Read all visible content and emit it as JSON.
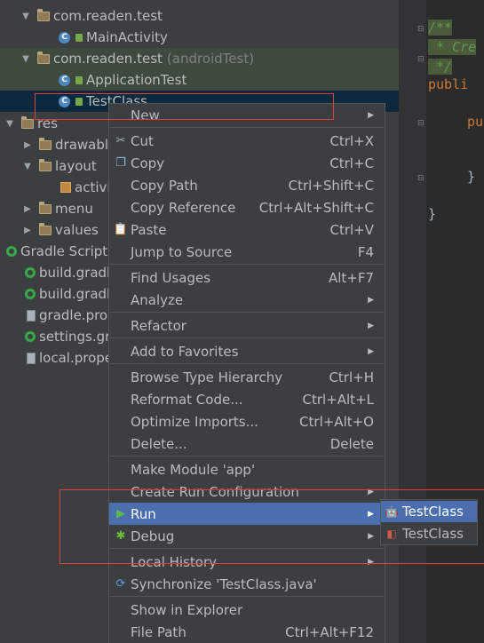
{
  "tree": {
    "rows": [
      {
        "label": "com.readen.test",
        "extra": ""
      },
      {
        "label": "MainActivity",
        "extra": ""
      },
      {
        "label": "com.readen.test",
        "extra": "(androidTest)"
      },
      {
        "label": "ApplicationTest",
        "extra": ""
      },
      {
        "label": "TestClass",
        "extra": ""
      },
      {
        "label": "res",
        "extra": ""
      },
      {
        "label": "drawabl",
        "extra": ""
      },
      {
        "label": "layout",
        "extra": ""
      },
      {
        "label": "activi",
        "extra": ""
      },
      {
        "label": "menu",
        "extra": ""
      },
      {
        "label": "values",
        "extra": ""
      },
      {
        "label": "Gradle Scripts",
        "extra": ""
      },
      {
        "label": "build.gradl",
        "extra": ""
      },
      {
        "label": "build.gradl",
        "extra": ""
      },
      {
        "label": "gradle.pro",
        "extra": ""
      },
      {
        "label": "settings.gr",
        "extra": ""
      },
      {
        "label": "local.prope",
        "extra": ""
      }
    ]
  },
  "editor": {
    "lines": [
      "/**",
      " * Cre",
      " */",
      "publi",
      "pu",
      "}",
      "}"
    ]
  },
  "menu": {
    "items": [
      {
        "label": "New",
        "shortcut": ""
      },
      {
        "label": "Cut",
        "shortcut": "Ctrl+X"
      },
      {
        "label": "Copy",
        "shortcut": "Ctrl+C"
      },
      {
        "label": "Copy Path",
        "shortcut": "Ctrl+Shift+C"
      },
      {
        "label": "Copy Reference",
        "shortcut": "Ctrl+Alt+Shift+C"
      },
      {
        "label": "Paste",
        "shortcut": "Ctrl+V"
      },
      {
        "label": "Jump to Source",
        "shortcut": "F4"
      },
      {
        "label": "Find Usages",
        "shortcut": "Alt+F7"
      },
      {
        "label": "Analyze",
        "shortcut": ""
      },
      {
        "label": "Refactor",
        "shortcut": ""
      },
      {
        "label": "Add to Favorites",
        "shortcut": ""
      },
      {
        "label": "Browse Type Hierarchy",
        "shortcut": "Ctrl+H"
      },
      {
        "label": "Reformat Code...",
        "shortcut": "Ctrl+Alt+L"
      },
      {
        "label": "Optimize Imports...",
        "shortcut": "Ctrl+Alt+O"
      },
      {
        "label": "Delete...",
        "shortcut": "Delete"
      },
      {
        "label": "Make Module 'app'",
        "shortcut": ""
      },
      {
        "label": "Create Run Configuration",
        "shortcut": ""
      },
      {
        "label": "Run",
        "shortcut": ""
      },
      {
        "label": "Debug",
        "shortcut": ""
      },
      {
        "label": "Local History",
        "shortcut": ""
      },
      {
        "label": "Synchronize 'TestClass.java'",
        "shortcut": ""
      },
      {
        "label": "Show in Explorer",
        "shortcut": ""
      },
      {
        "label": "File Path",
        "shortcut": "Ctrl+Alt+F12"
      }
    ]
  },
  "submenu": {
    "items": [
      {
        "label": "TestClass"
      },
      {
        "label": "TestClass"
      }
    ]
  },
  "colors": {
    "menu_highlight": "#4b6eaf",
    "annotation": "#e0403a",
    "selection": "#0d293e"
  }
}
